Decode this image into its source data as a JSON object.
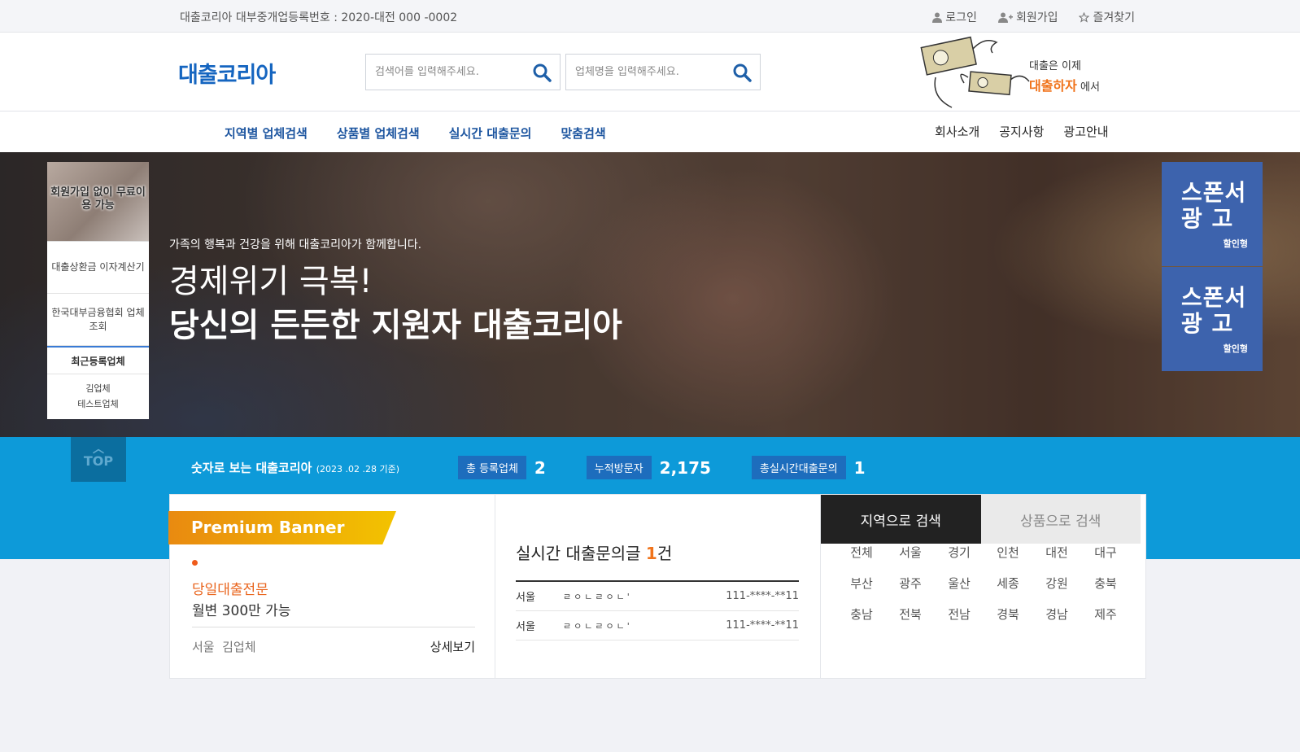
{
  "topbar": {
    "registration": "대출코리아 대부중개업등록번호 : 2020-대전 000 -0002",
    "login": "로그인",
    "signup": "회원가입",
    "favorite": "즐겨찾기"
  },
  "header": {
    "logo": "대출코리아",
    "search_keyword_placeholder": "검색어를 입력해주세요.",
    "search_company_placeholder": "업체명을 입력해주세요.",
    "ad_line1": "대출은 이제",
    "ad_highlight": "대출하자",
    "ad_suffix": "에서"
  },
  "nav": {
    "main": [
      "지역별 업체검색",
      "상품별 업체검색",
      "실시간 대출문의",
      "맞춤검색"
    ],
    "right": [
      "회사소개",
      "공지사항",
      "광고안내"
    ]
  },
  "hero": {
    "subtitle": "가족의 행복과 건강을 위해 대출코리아가 함께합니다.",
    "headline1": "경제위기 극복!",
    "headline2": "당신의 든든한 지원자 대출코리아"
  },
  "left_panel": {
    "banner": "회원가입 없이 무료이용 가능",
    "item1": "대출상환금 이자계산기",
    "item2": "한국대부금융협회 업체조회",
    "recent_title": "최근등록업체",
    "recent": [
      "김업체",
      "테스트업체"
    ]
  },
  "sponsors": [
    {
      "title1": "스폰서",
      "title2": "광 고",
      "tag": "할인형"
    },
    {
      "title1": "스폰서",
      "title2": "광 고",
      "tag": "할인형"
    }
  ],
  "stats": {
    "top_label": "TOP",
    "title": "숫자로 보는 대출코리아",
    "date": "(2023 .02 .28 기준)",
    "items": [
      {
        "label": "총 등록업체",
        "value": "2"
      },
      {
        "label": "누적방문자",
        "value": "2,175"
      },
      {
        "label": "총실시간대출문의",
        "value": "1"
      }
    ]
  },
  "premium": {
    "ribbon": "Premium Banner",
    "line1": "당일대출전문",
    "line2": "월변 300만 가능",
    "region_company": "서울  김업체",
    "detail": "상세보기"
  },
  "inquiry": {
    "title_prefix": "실시간 대출문의글 ",
    "count": "1",
    "title_suffix": "건",
    "rows": [
      {
        "region": "서울",
        "content": "ㄹㅇㄴㄹㅇㄴ'",
        "phone": "111-****-**11"
      },
      {
        "region": "서울",
        "content": "ㄹㅇㄴㄹㅇㄴ'",
        "phone": "111-****-**11"
      }
    ]
  },
  "region_search": {
    "tab_active": "지역으로 검색",
    "tab_inactive": "상품으로 검색",
    "regions": [
      "전체",
      "서울",
      "경기",
      "인천",
      "대전",
      "대구",
      "부산",
      "광주",
      "울산",
      "세종",
      "강원",
      "충북",
      "충남",
      "전북",
      "전남",
      "경북",
      "경남",
      "제주"
    ]
  }
}
